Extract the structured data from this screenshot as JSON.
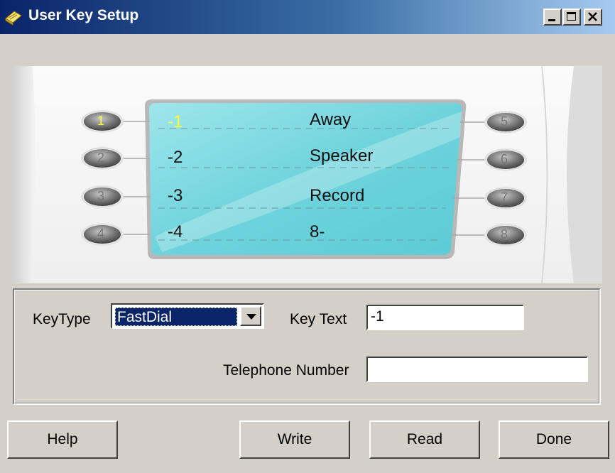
{
  "window": {
    "title": "User Key Setup",
    "controls": [
      "minimize",
      "maximize",
      "close"
    ]
  },
  "phone_display": {
    "rows": [
      {
        "left_label": "-1",
        "right_label": "Away",
        "left_color": "#ffff33"
      },
      {
        "left_label": "-2",
        "right_label": "Speaker",
        "left_color": "#111111"
      },
      {
        "left_label": "-3",
        "right_label": "Record",
        "left_color": "#111111"
      },
      {
        "left_label": "-4",
        "right_label": "8-",
        "left_color": "#111111"
      }
    ],
    "left_keys": [
      "1",
      "2",
      "3",
      "4"
    ],
    "right_keys": [
      "5",
      "6",
      "7",
      "8"
    ],
    "active_key": "1",
    "active_color": "#ffff33"
  },
  "form": {
    "key_type_label": "KeyType",
    "key_type_value": "FastDial",
    "key_text_label": "Key Text",
    "key_text_value": "-1",
    "telephone_label": "Telephone Number",
    "telephone_value": ""
  },
  "buttons": {
    "help": "Help",
    "write": "Write",
    "read": "Read",
    "done": "Done"
  }
}
